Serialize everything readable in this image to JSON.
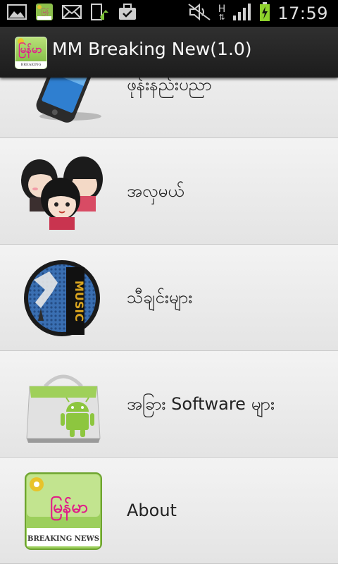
{
  "status_bar": {
    "time": "17:59",
    "network_type": "H",
    "icons": [
      "picture-icon",
      "app-notification-icon",
      "mail-icon",
      "download-icon",
      "briefcase-check-icon",
      "mute-icon",
      "signal-icon",
      "battery-charging-icon"
    ]
  },
  "action_bar": {
    "title": "MM Breaking New(1.0)",
    "icon_text": "မြန်မာ",
    "icon_caption": "BREAKING NEWS"
  },
  "menu": {
    "items": [
      {
        "label": "ဖုန်းနည်းပညာ",
        "icon": "phone-icon"
      },
      {
        "label": "အလှမယ်",
        "icon": "girls-icon"
      },
      {
        "label": "သီချင်းများ",
        "icon": "music-icon"
      },
      {
        "label": "အခြား Software များ",
        "icon": "android-bag-icon"
      },
      {
        "label": "About",
        "icon": "app-logo-icon"
      }
    ],
    "about_logo_text": "မြန်မာ",
    "about_logo_caption": "BREAKING NEWS",
    "music_logo_text": "MUSIC"
  }
}
